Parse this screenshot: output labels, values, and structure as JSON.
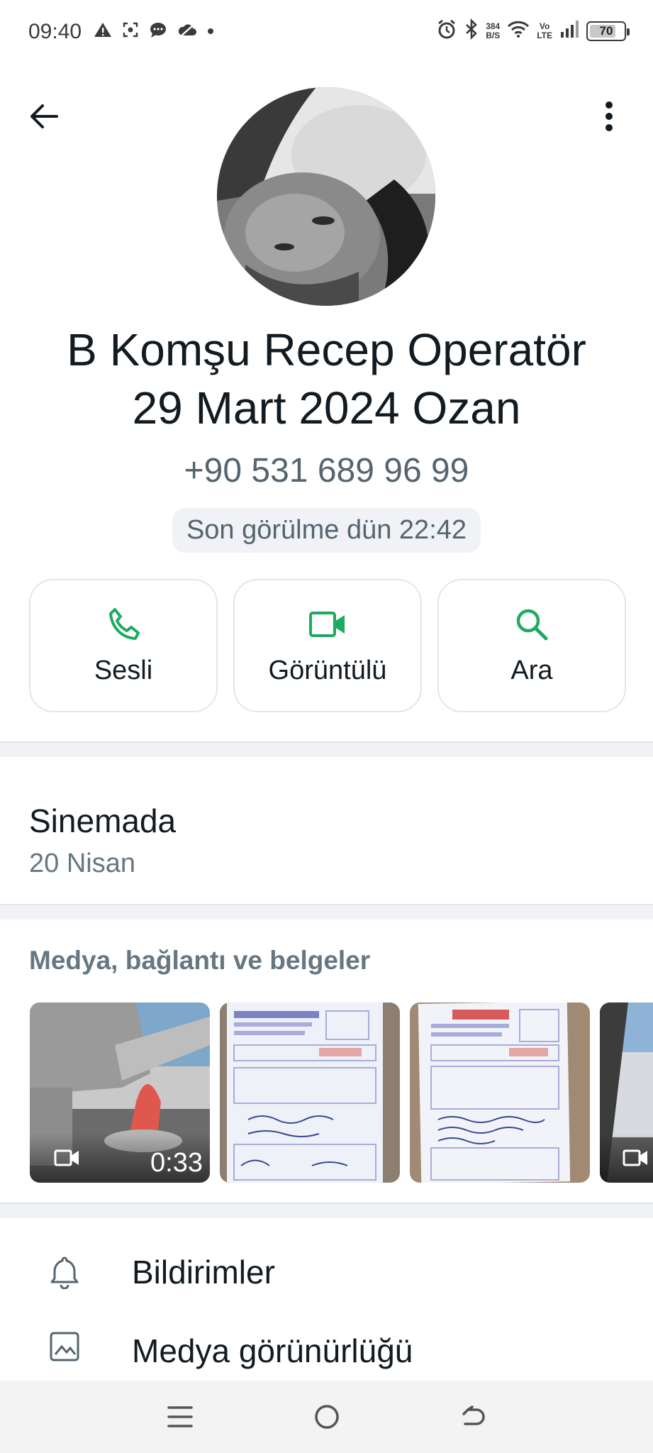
{
  "status_bar": {
    "time": "09:40",
    "speed_value": "384",
    "speed_unit": "B/S",
    "volte_top": "Vo",
    "volte_bottom": "LTE",
    "battery": "70",
    "left_icons": [
      "warning-icon",
      "screenshot-icon",
      "message-icon",
      "cloud-off-icon",
      "dot-icon"
    ],
    "right_icons": [
      "alarm-icon",
      "bluetooth-icon",
      "wifi-icon",
      "signal-icon",
      "battery-icon"
    ]
  },
  "header": {
    "back_icon": "arrow-left-icon",
    "more_icon": "more-vertical-icon"
  },
  "contact": {
    "name_line1": "B Komşu Recep Operatör",
    "name_line2": "29 Mart 2024 Ozan",
    "phone": "+90 531 689 96 99",
    "last_seen": "Son görülme dün 22:42"
  },
  "actions": [
    {
      "label": "Sesli",
      "icon": "phone-icon"
    },
    {
      "label": "Görüntülü",
      "icon": "video-icon"
    },
    {
      "label": "Ara",
      "icon": "search-icon"
    }
  ],
  "about": {
    "status": "Sinemada",
    "date": "20 Nisan"
  },
  "media": {
    "title": "Medya, bağlantı ve belgeler",
    "items": [
      {
        "kind": "video",
        "duration": "0:33"
      },
      {
        "kind": "image"
      },
      {
        "kind": "image"
      },
      {
        "kind": "video"
      }
    ]
  },
  "menu": [
    {
      "label": "Bildirimler",
      "icon": "bell-icon"
    },
    {
      "label": "Medya görünürlüğü",
      "icon": "image-icon"
    }
  ],
  "colors": {
    "accent": "#1daa61",
    "text_primary": "#111b21",
    "text_secondary": "#667781"
  }
}
